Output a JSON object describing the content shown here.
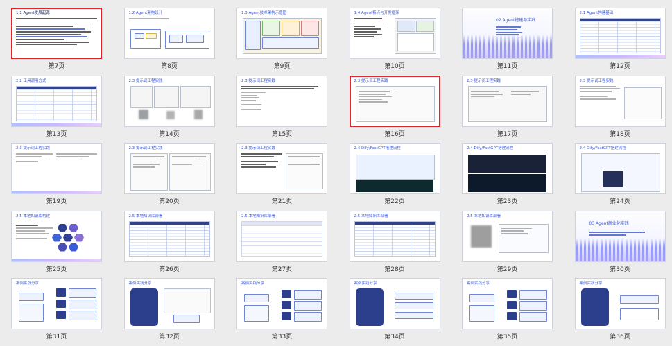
{
  "slides": [
    {
      "title": "1.1 Agent发展起源",
      "label": "第7页",
      "selected": true
    },
    {
      "title": "1.2 Agent架构设计",
      "label": "第8页"
    },
    {
      "title": "1.3 Agent技术架构示意图",
      "label": "第9页"
    },
    {
      "title": "1.4 Agent特点与开发框架",
      "label": "第10页"
    },
    {
      "title": "02 Agent搭建与实践",
      "label": "第11页"
    },
    {
      "title": "2.1 Agent构建基础",
      "label": "第12页"
    },
    {
      "title": "2.2 工具调用方式",
      "label": "第13页"
    },
    {
      "title": "2.3 提示词工程实践",
      "label": "第14页"
    },
    {
      "title": "2.3 提示词工程实践",
      "label": "第15页"
    },
    {
      "title": "2.3 提示词工程实践",
      "label": "第16页",
      "selected": true
    },
    {
      "title": "2.3 提示词工程实践",
      "label": "第17页"
    },
    {
      "title": "2.3 提示词工程实践",
      "label": "第18页"
    },
    {
      "title": "2.3 提示词工程实践",
      "label": "第19页"
    },
    {
      "title": "2.3 提示词工程实践",
      "label": "第20页"
    },
    {
      "title": "2.3 提示词工程实践",
      "label": "第21页"
    },
    {
      "title": "2.4 Dify/FastGPT搭建流程",
      "label": "第22页"
    },
    {
      "title": "2.4 Dify/FastGPT搭建流程",
      "label": "第23页"
    },
    {
      "title": "2.4 Dify/FastGPT搭建流程",
      "label": "第24页"
    },
    {
      "title": "2.5 本地知识库构建",
      "label": "第25页"
    },
    {
      "title": "2.5 本地知识库部署",
      "label": "第26页"
    },
    {
      "title": "2.5 本地知识库部署",
      "label": "第27页"
    },
    {
      "title": "2.5 本地知识库部署",
      "label": "第28页"
    },
    {
      "title": "2.5 本地知识库部署",
      "label": "第29页"
    },
    {
      "title": "03 Agent商业化实践",
      "label": "第30页"
    },
    {
      "title": "案例实践分享",
      "label": "第31页"
    },
    {
      "title": "案例实践分享",
      "label": "第32页"
    },
    {
      "title": "案例实践分享",
      "label": "第33页"
    },
    {
      "title": "案例实践分享",
      "label": "第34页"
    },
    {
      "title": "案例实践分享",
      "label": "第35页"
    },
    {
      "title": "案例实践分享",
      "label": "第36页"
    }
  ],
  "colors": {
    "selected_border": "#e0242b",
    "accent": "#3b5bdb",
    "dark_blue": "#2c3f8c"
  }
}
